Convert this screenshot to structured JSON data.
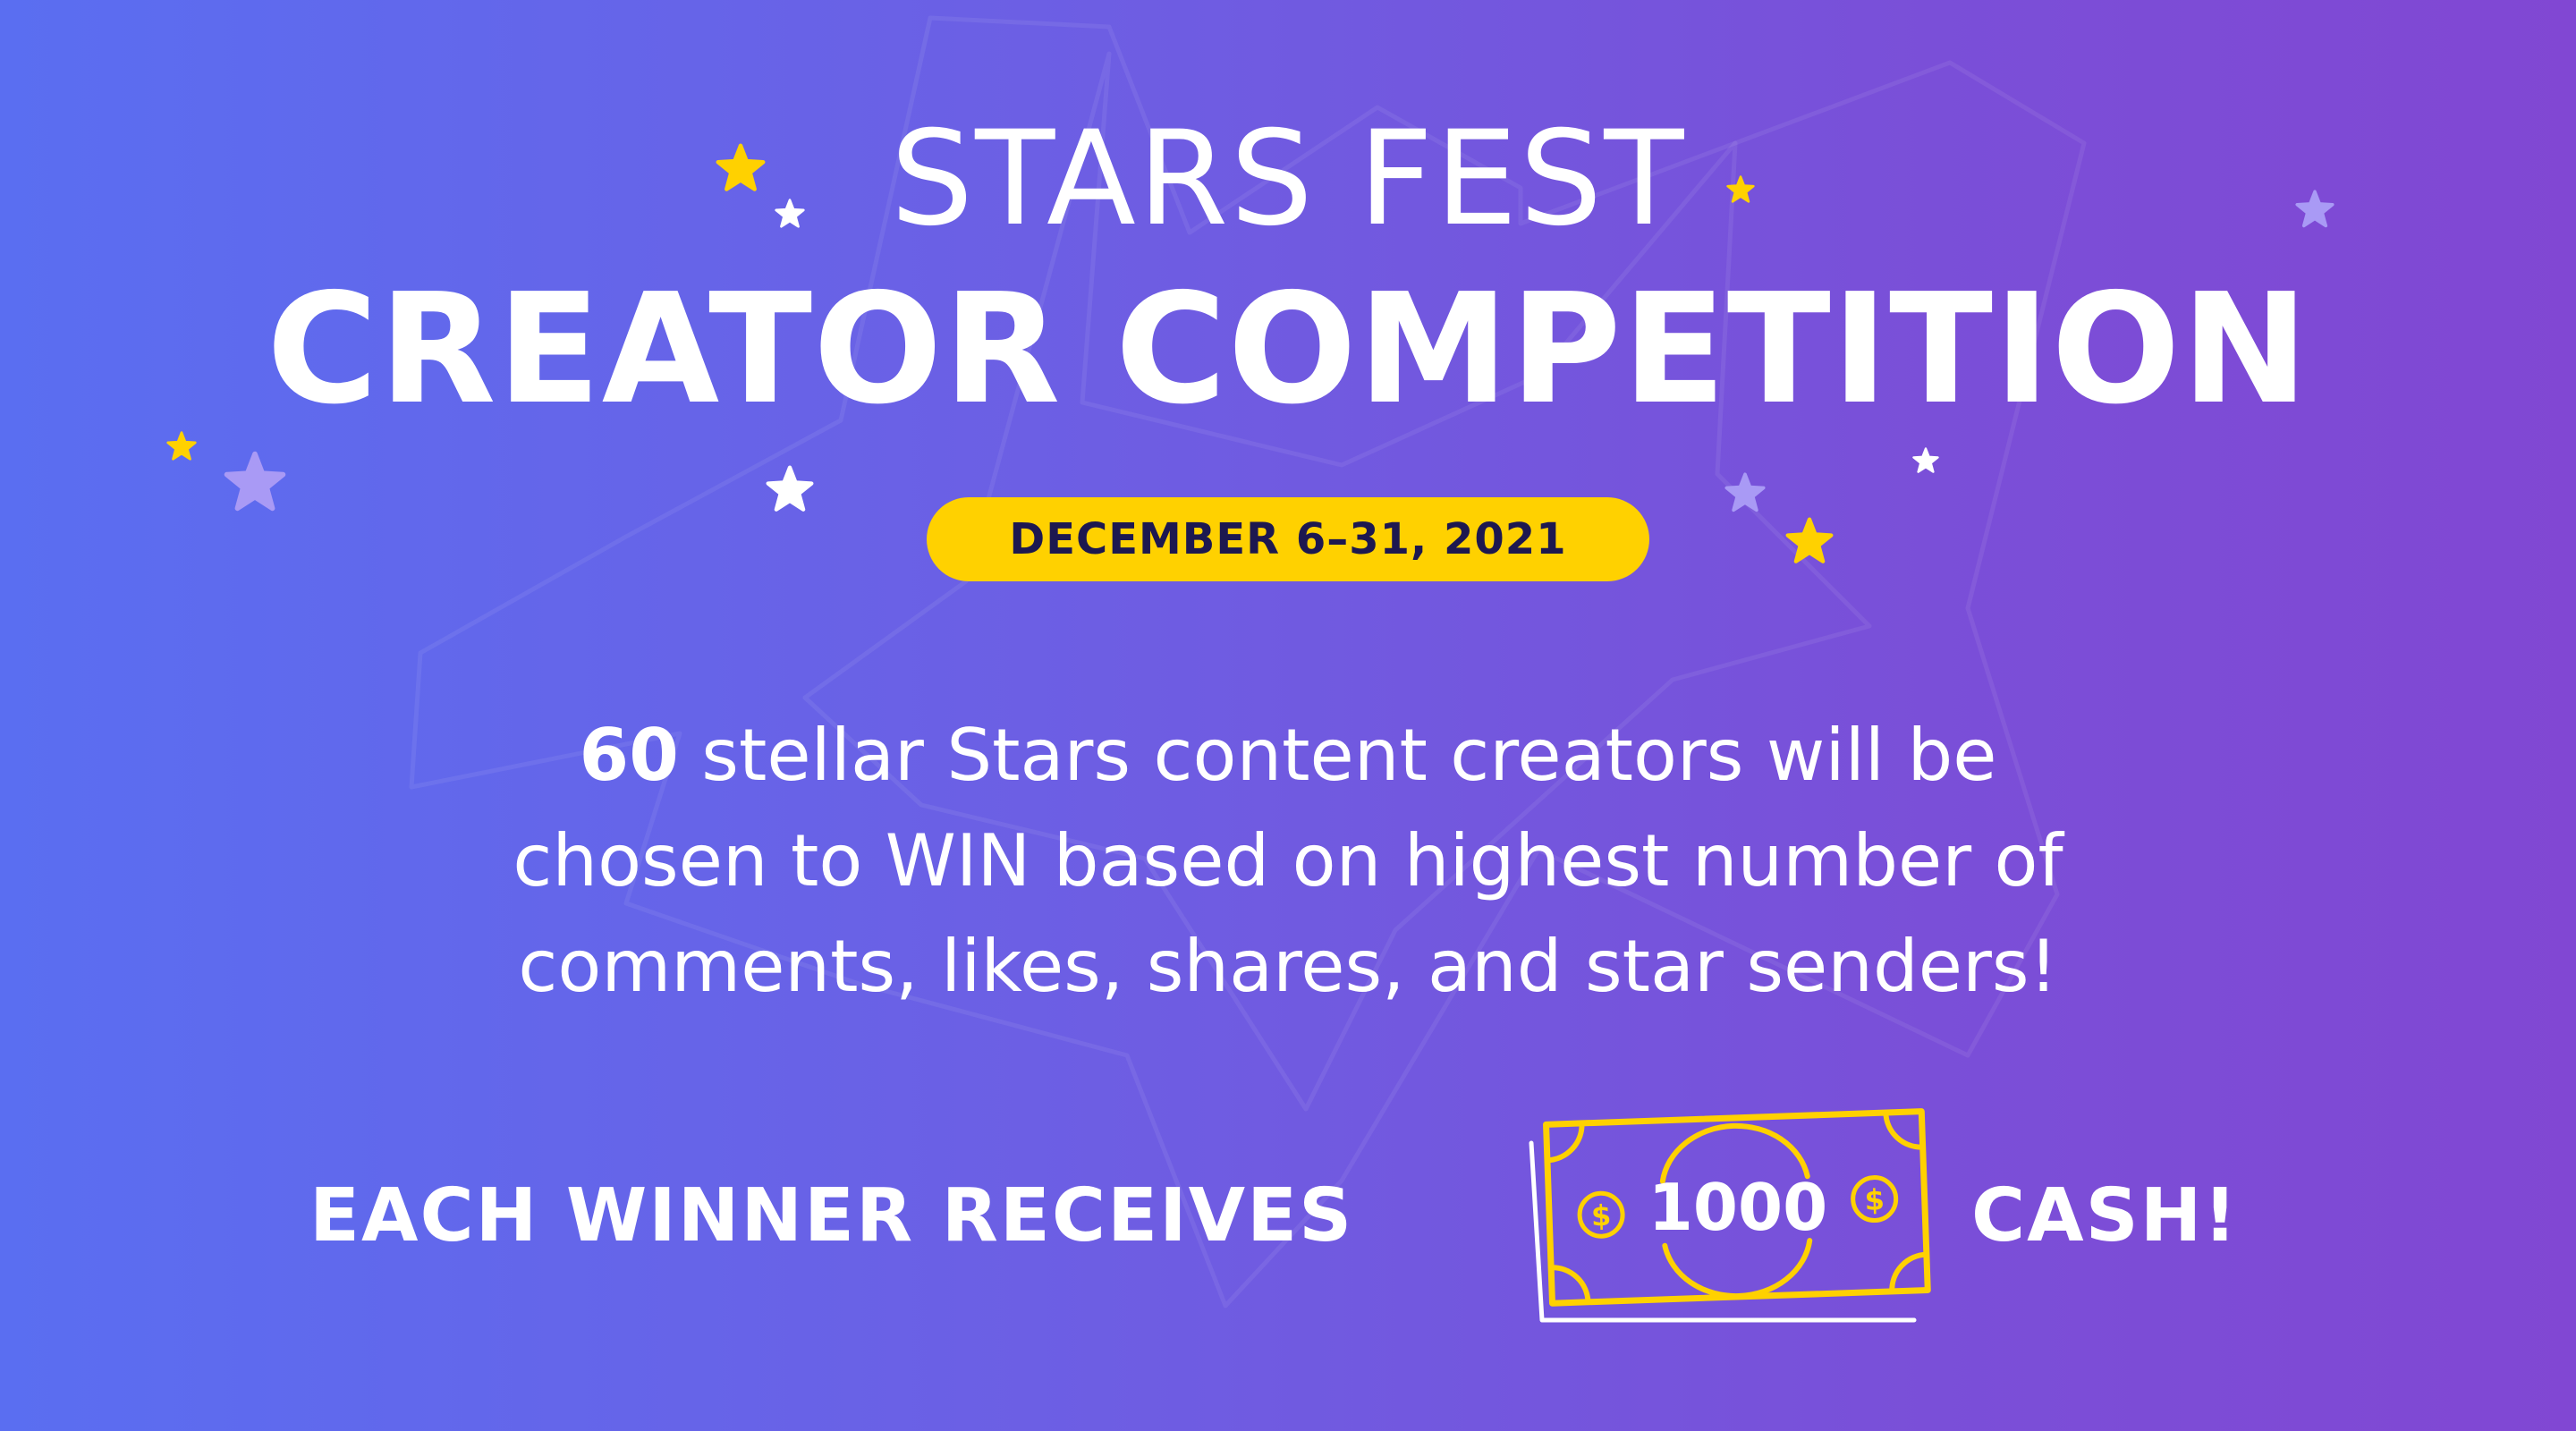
{
  "title": {
    "line1": "STARS FEST",
    "line2": "CREATOR COMPETITION"
  },
  "date": "DECEMBER 6–31, 2021",
  "description": {
    "count": "60",
    "line1_rest": " stellar Stars content creators will be",
    "line2": "chosen to WIN based on highest number of",
    "line3": "comments, likes, shares, and star senders!"
  },
  "prize": {
    "lead": "EACH WINNER RECEIVES",
    "amount": "1000",
    "currency_symbol": "$",
    "tail": "CASH!"
  },
  "colors": {
    "background_left": "#5a6ef1",
    "background_right": "#8147d3",
    "accent_yellow": "#ffd100",
    "date_text": "#1d1850",
    "text": "#ffffff",
    "star_lavender": "#a99af5"
  },
  "icons": [
    "star-icon",
    "cash-bill-icon",
    "dollar-coin-icon"
  ]
}
